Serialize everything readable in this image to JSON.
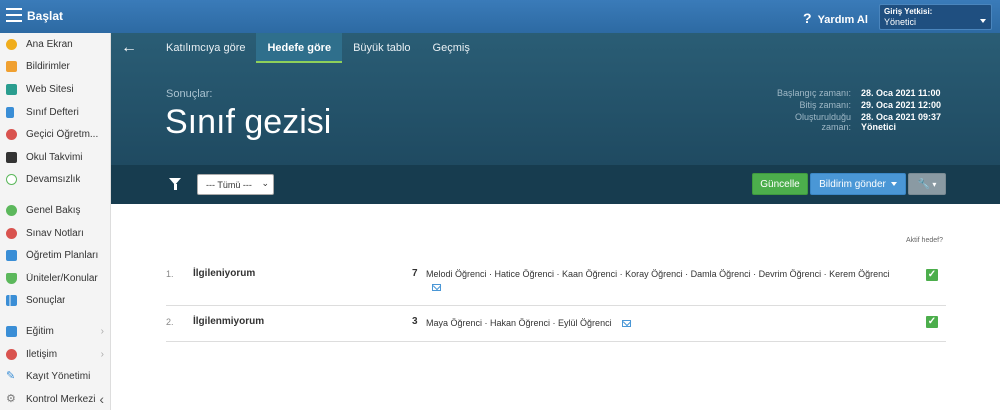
{
  "topbar": {
    "brand": "Başlat",
    "help_label": "Yardım Al",
    "auth_title": "Giriş Yetkisi:",
    "auth_value": "Yönetici"
  },
  "sidebar": {
    "items": [
      {
        "label": "Ana Ekran",
        "icon": "star-icon",
        "color": "#f0ad1c"
      },
      {
        "label": "Bildirimler",
        "icon": "envelope-icon",
        "color": "#f0a030"
      },
      {
        "label": "Web Sitesi",
        "icon": "home-icon",
        "color": "#2a9d8f"
      },
      {
        "label": "Sınıf Defteri",
        "icon": "book-icon",
        "color": "#3a8ed6"
      },
      {
        "label": "Geçici Öğretm...",
        "icon": "user-icon",
        "color": "#d9534f"
      },
      {
        "label": "Okul Takvimi",
        "icon": "calendar-icon",
        "color": "#333333"
      },
      {
        "label": "Devamsızlık",
        "icon": "person-icon",
        "color": "#5cb85c"
      },
      {
        "label": "Genel Bakış",
        "icon": "overview-icon",
        "color": "#5cb85c"
      },
      {
        "label": "Sınav Notları",
        "icon": "grades-icon",
        "color": "#d9534f"
      },
      {
        "label": "Öğretim Planları",
        "icon": "plan-icon",
        "color": "#3a8ed6"
      },
      {
        "label": "Üniteler/Konular",
        "icon": "shield-icon",
        "color": "#5cb85c"
      },
      {
        "label": "Sonuçlar",
        "icon": "chart-icon",
        "color": "#3a8ed6"
      },
      {
        "label": "Eğitim",
        "icon": "briefcase-icon",
        "color": "#3a8ed6"
      },
      {
        "label": "İletişim",
        "icon": "chat-icon",
        "color": "#d9534f"
      },
      {
        "label": "Kayıt Yönetimi",
        "icon": "pencil-icon",
        "color": "#3a8ed6"
      },
      {
        "label": "Kontrol Merkezi",
        "icon": "gear-icon",
        "color": "#777777"
      }
    ]
  },
  "header": {
    "tabs": [
      "Katılımcıya göre",
      "Hedefe göre",
      "Büyük tablo",
      "Geçmiş"
    ],
    "active_tab": "Hedefe göre",
    "results_label": "Sonuçlar:",
    "title": "Sınıf gezisi",
    "meta": [
      {
        "key": "Başlangıç zamanı:",
        "value": "28. Oca 2021 11:00"
      },
      {
        "key": "Bitiş zamanı:",
        "value": "29. Oca 2021 12:00"
      },
      {
        "key": "Oluşturulduğu zaman:",
        "value": "28. Oca 2021 09:37 Yönetici"
      }
    ]
  },
  "toolbar": {
    "filter_value": "--- Tümü ---",
    "update_button": "Güncelle",
    "notify_button": "Bildirim gönder"
  },
  "content": {
    "active_goal_label": "Aktif hedef?",
    "rows": [
      {
        "num": "1.",
        "name": "İlgileniyorum",
        "count": "7",
        "people": "Melodi Öğrenci · Hatice Öğrenci · Kaan Öğrenci · Koray Öğrenci · Damla Öğrenci · Devrim Öğrenci · Kerem Öğrenci"
      },
      {
        "num": "2.",
        "name": "İlgilenmiyorum",
        "count": "3",
        "people": "Maya Öğrenci · Hakan Öğrenci · Eylül Öğrenci"
      }
    ]
  }
}
